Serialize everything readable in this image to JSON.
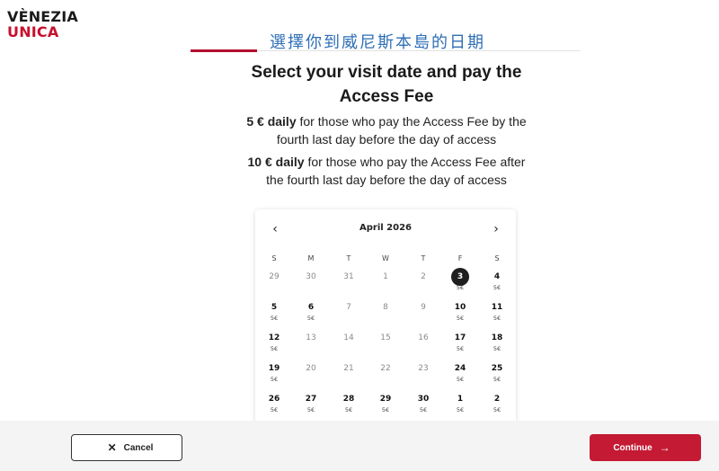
{
  "brand": {
    "line1": "VÈNEZIA",
    "line2": "UNICA"
  },
  "annotation": "選擇你到威尼斯本島的日期",
  "title": "Select your visit date and pay the Access Fee",
  "fee1": {
    "bold": "5 € daily",
    "text": " for those who pay the Access Fee by the fourth last day before the day of access"
  },
  "fee2": {
    "bold": "10 € daily",
    "text": " for those who pay the Access Fee after the fourth last day before the day of access"
  },
  "progress": {
    "fraction": 0.17
  },
  "calendar": {
    "month": "April 2026",
    "prev_icon": "chevron-left-icon",
    "next_icon": "chevron-right-icon",
    "weekdays": [
      "S",
      "M",
      "T",
      "W",
      "T",
      "F",
      "S"
    ],
    "weeks": [
      [
        {
          "d": "29",
          "s": "dim"
        },
        {
          "d": "30",
          "s": "dim"
        },
        {
          "d": "31",
          "s": "dim"
        },
        {
          "d": "1",
          "s": "dim"
        },
        {
          "d": "2",
          "s": "dim"
        },
        {
          "d": "3",
          "s": "sel",
          "p": "5€"
        },
        {
          "d": "4",
          "s": "avail",
          "p": "5€"
        }
      ],
      [
        {
          "d": "5",
          "s": "avail",
          "p": "5€"
        },
        {
          "d": "6",
          "s": "avail",
          "p": "5€"
        },
        {
          "d": "7",
          "s": "dim"
        },
        {
          "d": "8",
          "s": "dim"
        },
        {
          "d": "9",
          "s": "dim"
        },
        {
          "d": "10",
          "s": "avail",
          "p": "5€"
        },
        {
          "d": "11",
          "s": "avail",
          "p": "5€"
        }
      ],
      [
        {
          "d": "12",
          "s": "avail",
          "p": "5€"
        },
        {
          "d": "13",
          "s": "dim"
        },
        {
          "d": "14",
          "s": "dim"
        },
        {
          "d": "15",
          "s": "dim"
        },
        {
          "d": "16",
          "s": "dim"
        },
        {
          "d": "17",
          "s": "avail",
          "p": "5€"
        },
        {
          "d": "18",
          "s": "avail",
          "p": "5€"
        }
      ],
      [
        {
          "d": "19",
          "s": "avail",
          "p": "5€"
        },
        {
          "d": "20",
          "s": "dim"
        },
        {
          "d": "21",
          "s": "dim"
        },
        {
          "d": "22",
          "s": "dim"
        },
        {
          "d": "23",
          "s": "dim"
        },
        {
          "d": "24",
          "s": "avail",
          "p": "5€"
        },
        {
          "d": "25",
          "s": "avail",
          "p": "5€"
        }
      ],
      [
        {
          "d": "26",
          "s": "avail",
          "p": "5€"
        },
        {
          "d": "27",
          "s": "avail",
          "p": "5€"
        },
        {
          "d": "28",
          "s": "avail",
          "p": "5€"
        },
        {
          "d": "29",
          "s": "avail",
          "p": "5€"
        },
        {
          "d": "30",
          "s": "avail",
          "p": "5€"
        },
        {
          "d": "1",
          "s": "avail",
          "p": "5€"
        },
        {
          "d": "2",
          "s": "avail",
          "p": "5€"
        }
      ]
    ]
  },
  "footer": {
    "cancel_label": "Cancel",
    "continue_label": "Continue"
  },
  "colors": {
    "brand_red": "#c8102e",
    "accent": "#c41a34",
    "annotation": "#2f6fb5"
  }
}
